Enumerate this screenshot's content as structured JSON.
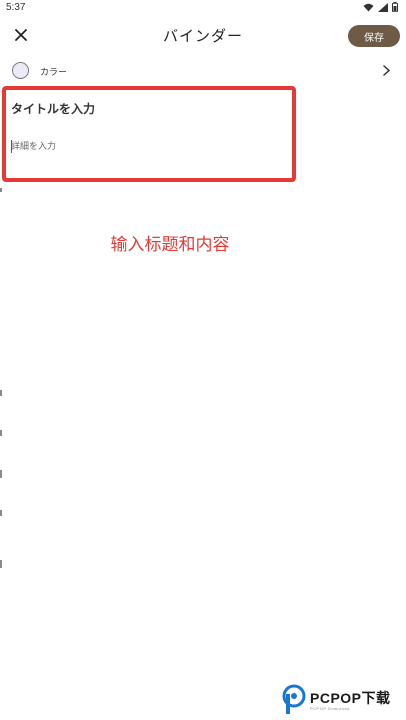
{
  "status_bar": {
    "time": "5:37",
    "icons": [
      "wifi-icon",
      "signal-icon",
      "battery-icon"
    ]
  },
  "app_bar": {
    "title": "バインダー",
    "close_icon": "close-icon",
    "save_label": "保存"
  },
  "color_row": {
    "label": "カラー",
    "swatch_color": "#eceaf6",
    "chevron_icon": "chevron-right-icon"
  },
  "form": {
    "title_placeholder": "タイトルを入力",
    "title_value": "",
    "detail_placeholder": "詳細を入力",
    "detail_value": ""
  },
  "annotation": {
    "text": "输入标题和内容",
    "color": "#e53935"
  },
  "watermark": {
    "text": "PCPOP下载",
    "subtext": "PCPOP Download"
  },
  "colors": {
    "accent": "#6e5a45",
    "highlight": "#e53935"
  }
}
